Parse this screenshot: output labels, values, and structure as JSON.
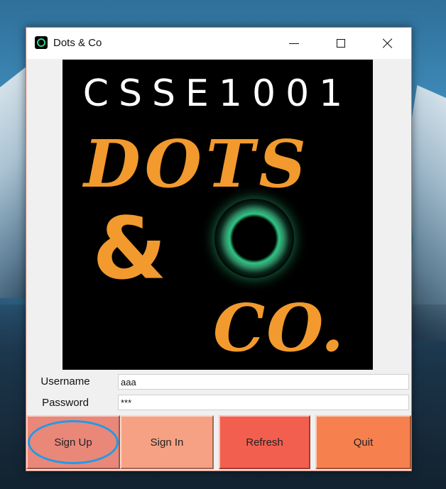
{
  "window": {
    "title": "Dots & Co",
    "controls": [
      "minimize-icon",
      "maximize-icon",
      "close-icon"
    ]
  },
  "logo": {
    "top_text": "CSSE1001",
    "line1": "DOTS",
    "ampersand": "&",
    "line3": "CO."
  },
  "form": {
    "username_label": "Username",
    "username_value": "aaa",
    "password_label": "Password",
    "password_value": "***"
  },
  "buttons": {
    "signup": "Sign Up",
    "signin": "Sign In",
    "refresh": "Refresh",
    "quit": "Quit"
  },
  "colors": {
    "signup": "#e98779",
    "signin": "#f6a183",
    "refresh": "#f35f4f",
    "quit": "#f6814f",
    "logo_orange": "#f29a2e",
    "ring_green": "#2fd18a",
    "highlight": "#1f9be8"
  }
}
